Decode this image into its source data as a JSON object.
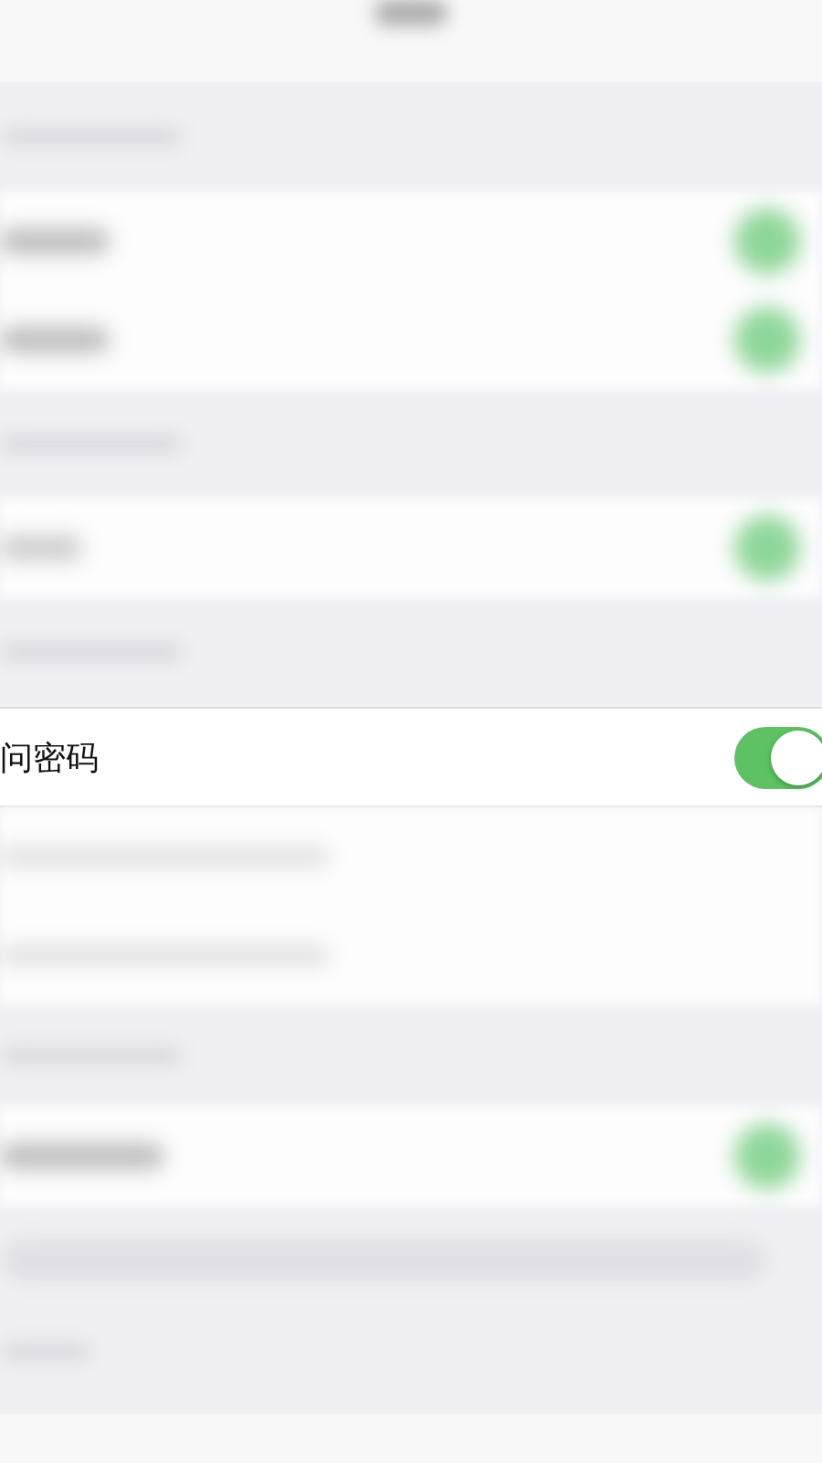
{
  "blurred_switches": [
    {
      "on": true
    },
    {
      "on": true
    },
    {
      "on": true
    },
    {
      "on": true
    }
  ],
  "row": {
    "label": "问密码",
    "on": true
  }
}
